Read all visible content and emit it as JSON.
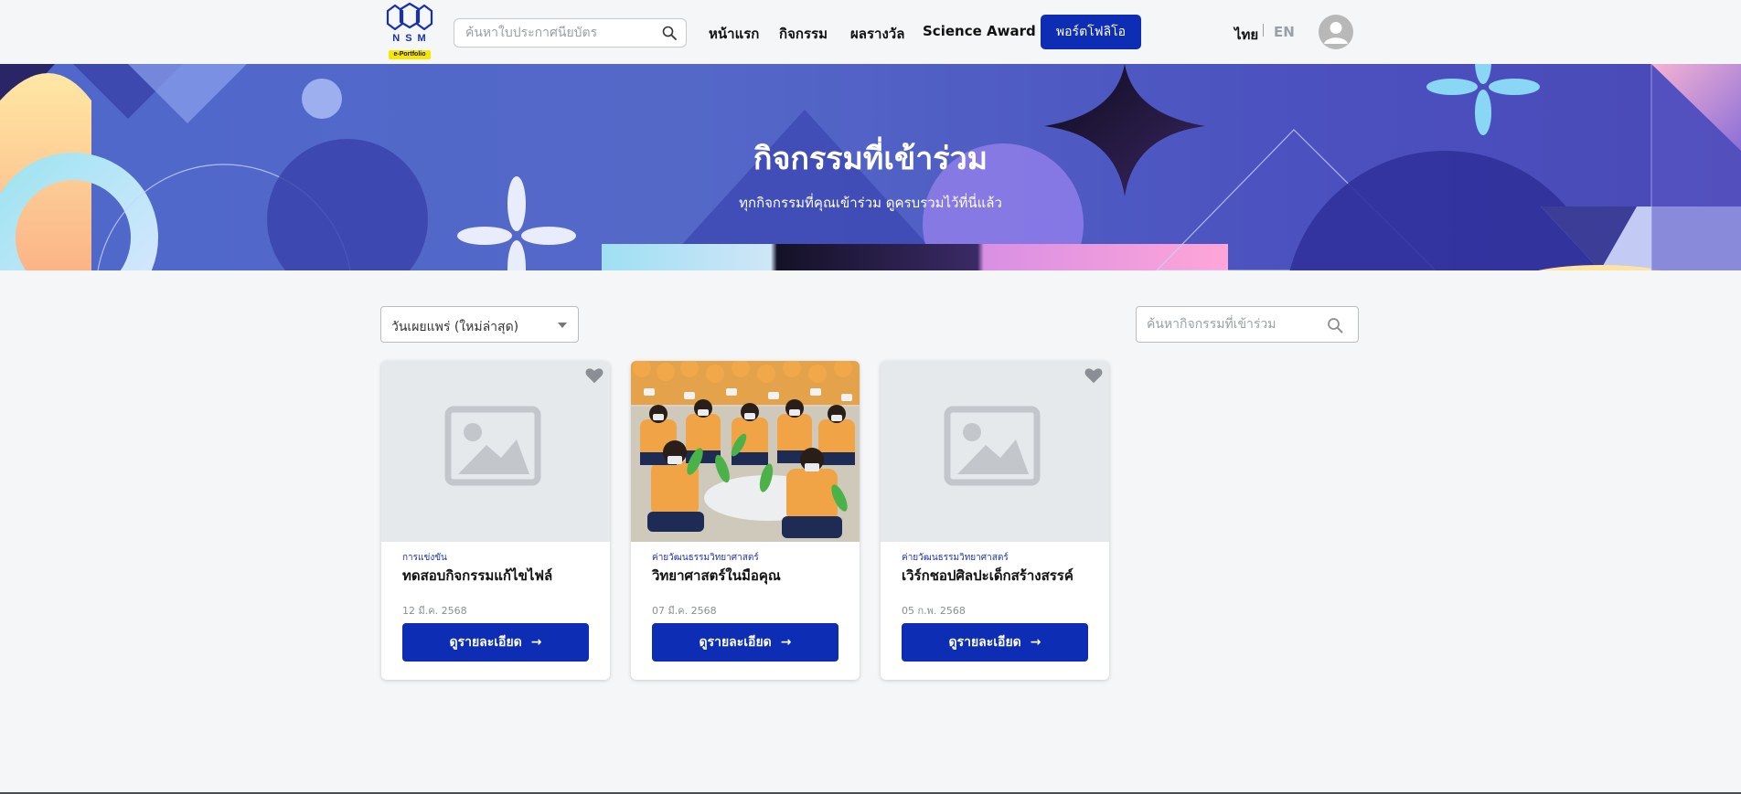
{
  "header": {
    "logo_text": "NSM",
    "logo_badge": "e-Portfolio",
    "search_placeholder": "ค้นหาใบประกาศนียบัตร",
    "nav": {
      "home": "หน้าแรก",
      "activities": "กิจกรรม",
      "awards": "ผลรางวัล",
      "science_award": "Science Award",
      "portfolio": "พอร์ตโฟลิโอ"
    },
    "lang_th": "ไทย",
    "lang_en": "EN"
  },
  "hero": {
    "title": "กิจกรรมที่เข้าร่วม",
    "subtitle": "ทุกกิจกรรมที่คุณเข้าร่วม ดูครบรวมไว้ที่นี่แล้ว"
  },
  "toolbar": {
    "sort_value": "วันเผยแพร่ (ใหม่ล่าสุด)",
    "search_placeholder": "ค้นหากิจกรรมที่เข้าร่วม"
  },
  "cards": [
    {
      "category": "การแข่งขัน",
      "title": "ทดสอบกิจกรรมแก้ไขไฟล์",
      "date": "12 มี.ค. 2568",
      "button": "ดูรายละเอียด",
      "image": "placeholder-image-icon"
    },
    {
      "category": "ค่ายวัฒนธรรมวิทยาศาสตร์",
      "title": "วิทยาศาสตร์ในมือคุณ",
      "date": "07 มี.ค. 2568",
      "button": "ดูรายละเอียด",
      "image": "students-photo"
    },
    {
      "category": "ค่ายวัฒนธรรมวิทยาศาสตร์",
      "title": "เวิร์กชอปศิลปะเด็กสร้างสรรค์",
      "date": "05 ก.พ. 2568",
      "button": "ดูรายละเอียด",
      "image": "placeholder-image-icon"
    }
  ],
  "colors": {
    "primary": "#0c2db4",
    "category_text": "#1b35b9",
    "hero_bg": "#5064c8",
    "page_bg": "#f4f6f8"
  }
}
